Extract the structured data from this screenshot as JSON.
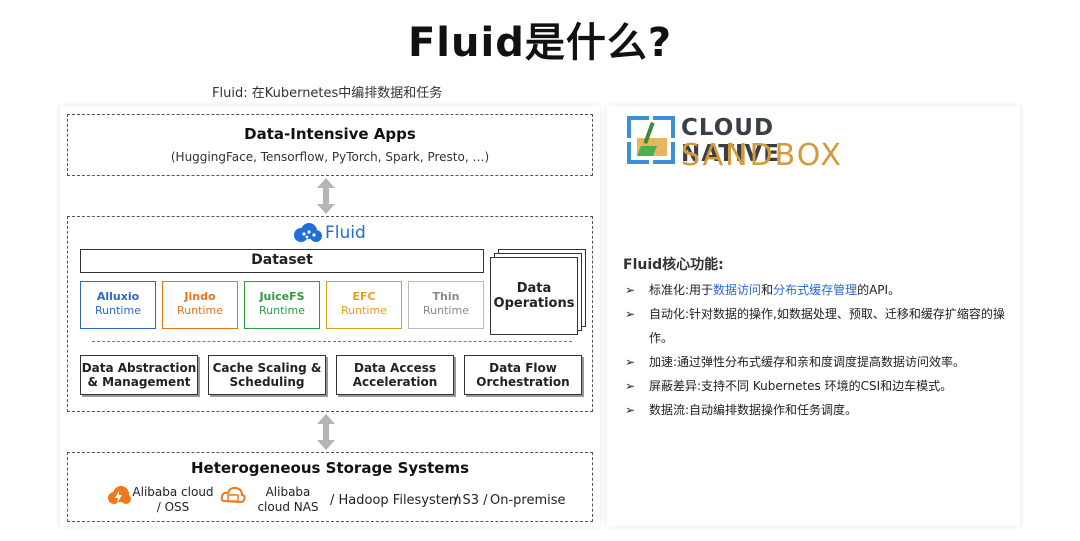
{
  "title": "Fluid是什么?",
  "subtitle": "Fluid: 在Kubernetes中编排数据和任务",
  "apps": {
    "title": "Data-Intensive Apps",
    "subtitle": "(HuggingFace, Tensorflow, PyTorch, Spark, Presto, …)"
  },
  "fluid": {
    "logo_text": "Fluid",
    "dataset_label": "Dataset",
    "runtimes": [
      {
        "name": "Alluxio",
        "sub": "Runtime",
        "color": "#2f67c9"
      },
      {
        "name": "Jindo",
        "sub": "Runtime",
        "color": "#e8731a"
      },
      {
        "name": "JuiceFS",
        "sub": "Runtime",
        "color": "#2a9d3e"
      },
      {
        "name": "EFC",
        "sub": "Runtime",
        "color": "#e0a11a"
      },
      {
        "name": "Thin",
        "sub": "Runtime",
        "color": "#888888"
      }
    ],
    "data_operations": "Data Operations",
    "capabilities": [
      "Data Abstraction & Management",
      "Cache Scaling & Scheduling",
      "Data Access Acceleration",
      "Data Flow Orchestration"
    ]
  },
  "storage": {
    "title": "Heterogeneous Storage Systems",
    "items": {
      "oss": "Alibaba cloud / OSS",
      "nas": "Alibaba cloud NAS",
      "hdfs": "/ Hadoop Filesystem",
      "s3": "/ S3 /",
      "onprem": "On-premise"
    }
  },
  "cns": {
    "line1": "CLOUD NATIVE",
    "line2": "SANDBOX"
  },
  "features": {
    "heading": "Fluid核心功能:",
    "bullet": "➢",
    "items": [
      {
        "pre": "标准化:用于",
        "hl1": "数据访问",
        "mid": "和",
        "hl2": "分布式缓存管理",
        "post": "的API。"
      },
      {
        "text": "自动化:针对数据的操作,如数据处理、预取、迁移和缓存扩缩容的操作。"
      },
      {
        "text": "加速:通过弹性分布式缓存和亲和度调度提高数据访问效率。"
      },
      {
        "text": "屏蔽差异:支持不同 Kubernetes 环境的CSI和边车模式。"
      },
      {
        "text": "数据流:自动编排数据操作和任务调度。"
      }
    ]
  },
  "colors": {
    "accent_blue": "#2f67c9",
    "orange": "#e8731a",
    "green": "#2a9d3e",
    "gold": "#e0a11a",
    "gray": "#888888"
  }
}
